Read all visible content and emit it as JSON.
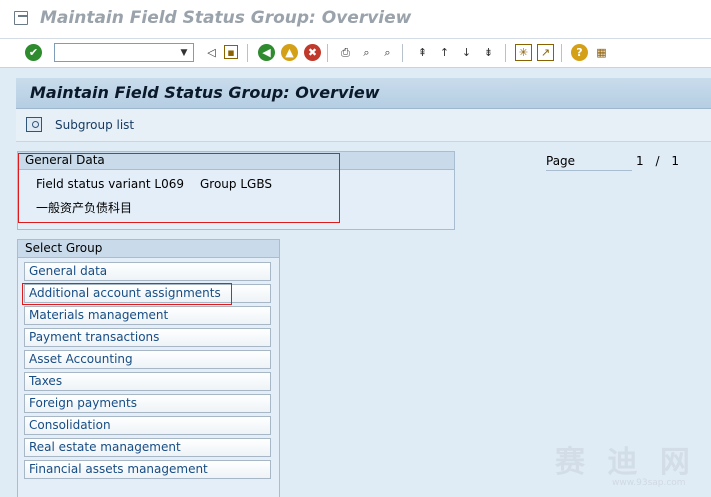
{
  "window": {
    "title": "Maintain Field Status Group: Overview"
  },
  "toolbar": {
    "command_field_value": "",
    "buttons": [
      {
        "name": "enter-icon",
        "glyph": "✔",
        "color": "#2e8b2e",
        "round": true
      },
      {
        "name": "back-arrow-icon",
        "glyph": "◁",
        "color": "#333"
      },
      {
        "name": "save-icon",
        "glyph": "▣",
        "color": "#b8860b"
      },
      {
        "name": "back-icon",
        "glyph": "◀",
        "color": "#2e8b2e",
        "round": true
      },
      {
        "name": "exit-icon",
        "glyph": "▲",
        "color": "#d4a017",
        "round": true
      },
      {
        "name": "cancel-icon",
        "glyph": "✖",
        "color": "#c0392b",
        "round": true
      },
      {
        "name": "print-icon",
        "glyph": "⎙",
        "color": "#333"
      },
      {
        "name": "find-icon",
        "glyph": "⌕",
        "color": "#333"
      },
      {
        "name": "find-next-icon",
        "glyph": "⌕",
        "color": "#333"
      },
      {
        "name": "first-page-icon",
        "glyph": "⇞",
        "color": "#555"
      },
      {
        "name": "previous-page-icon",
        "glyph": "↑",
        "color": "#555"
      },
      {
        "name": "next-page-icon",
        "glyph": "↓",
        "color": "#555"
      },
      {
        "name": "last-page-icon",
        "glyph": "⇟",
        "color": "#555"
      },
      {
        "name": "create-session-icon",
        "glyph": "✳",
        "color": "#7a5c00"
      },
      {
        "name": "shortcut-icon",
        "glyph": "↗",
        "color": "#7a5c00"
      },
      {
        "name": "help-icon",
        "glyph": "?",
        "color": "#d4a017",
        "round": true
      },
      {
        "name": "layout-menu-icon",
        "glyph": "▦",
        "color": "#8a5a00"
      }
    ]
  },
  "header": {
    "title": "Maintain Field Status Group: Overview"
  },
  "app_toolbar": {
    "subgroup_label": "Subgroup list"
  },
  "general_data": {
    "title": "General Data",
    "field_status_variant": "Field status variant L069",
    "group": "Group LGBS",
    "description": "一般资产负债科目"
  },
  "page": {
    "label": "Page",
    "current": "1",
    "separator": "/",
    "total": "1"
  },
  "select_group": {
    "title": "Select Group",
    "items": [
      "General data",
      "Additional account assignments",
      "Materials management",
      "Payment transactions",
      "Asset Accounting",
      "Taxes",
      "Foreign payments",
      "Consolidation",
      "Real estate management",
      "Financial assets management"
    ]
  },
  "colors": {
    "highlight_red": "#e0191b",
    "link_blue": "#174d85",
    "panel_bg": "#e3eef8"
  },
  "watermark": {
    "text": "赛 迪 网",
    "url": "www.93sap.com"
  }
}
